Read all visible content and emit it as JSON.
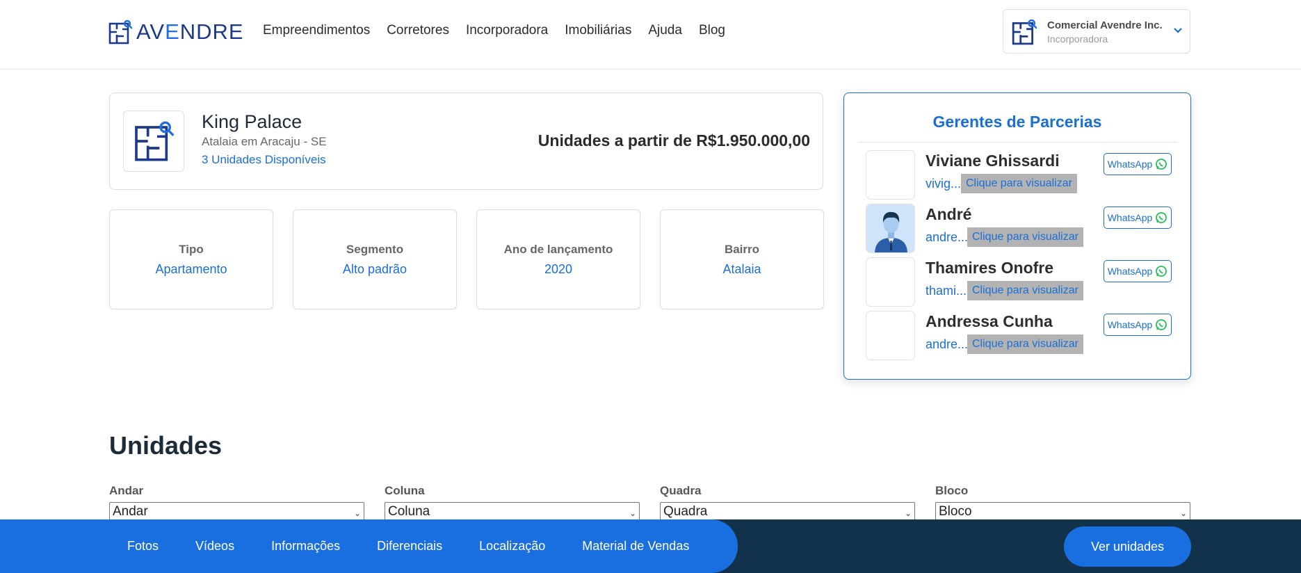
{
  "header": {
    "logo_text_a": "AV",
    "logo_text_b": "E",
    "logo_text_c": "NDRE",
    "nav": [
      "Empreendimentos",
      "Corretores",
      "Incorporadora",
      "Imobiliárias",
      "Ajuda",
      "Blog"
    ],
    "account": {
      "name": "Comercial Avendre Inc.",
      "role": "Incorporadora"
    }
  },
  "property": {
    "name": "King Palace",
    "location": "Atalaia em Aracaju - SE",
    "units_available": "3 Unidades Disponíveis",
    "price": "Unidades a partir de R$1.950.000,00"
  },
  "info": [
    {
      "label": "Tipo",
      "value": "Apartamento"
    },
    {
      "label": "Segmento",
      "value": "Alto padrão"
    },
    {
      "label": "Ano de lançamento",
      "value": "2020"
    },
    {
      "label": "Bairro",
      "value": "Atalaia"
    }
  ],
  "managers": {
    "title": "Gerentes de Parcerias",
    "reveal_label": "Clique para visualizar",
    "whatsapp_label": "WhatsApp",
    "items": [
      {
        "name": "Viviane Ghissardi",
        "email": "vivig..."
      },
      {
        "name": "André",
        "email": "andre..."
      },
      {
        "name": "Thamires Onofre",
        "email": "thami..."
      },
      {
        "name": "Andressa Cunha",
        "email": "andre..."
      }
    ]
  },
  "units": {
    "title": "Unidades",
    "filters": [
      {
        "label": "Andar",
        "value": "Andar"
      },
      {
        "label": "Coluna",
        "value": "Coluna"
      },
      {
        "label": "Quadra",
        "value": "Quadra"
      },
      {
        "label": "Bloco",
        "value": "Bloco"
      }
    ]
  },
  "bottom_bar": {
    "tabs": [
      "Fotos",
      "Vídeos",
      "Informações",
      "Diferenciais",
      "Localização",
      "Material de Vendas"
    ],
    "cta": "Ver unidades"
  },
  "colors": {
    "primary": "#1a6fe0",
    "dark": "#12324b",
    "text": "#2b2b2b"
  }
}
